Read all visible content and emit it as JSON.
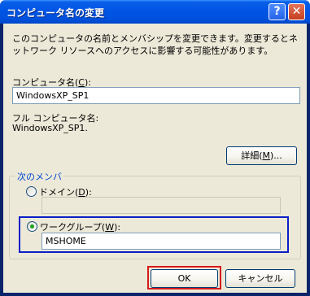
{
  "window": {
    "title": "コンピュータ名の変更",
    "help_button": "?",
    "close_button": "✕"
  },
  "description": "このコンピュータの名前とメンバシップを変更できます。変更するとネットワーク リソースへのアクセスに影響する可能性があります。",
  "computer_name": {
    "label_text": "コンピュータ名(",
    "label_key": "C",
    "label_end": "):",
    "value": "WindowsXP_SP1"
  },
  "full_name": {
    "label": "フル コンピュータ名:",
    "value": "WindowsXP_SP1."
  },
  "details_button": {
    "text": "詳細(",
    "key": "M",
    "end": ")..."
  },
  "member_group": {
    "title": "次のメンバ",
    "domain": {
      "label_text": "ドメイン(",
      "label_key": "D",
      "label_end": "):",
      "value": "",
      "selected": false
    },
    "workgroup": {
      "label_text": "ワークグループ(",
      "label_key": "W",
      "label_end": "):",
      "value": "MSHOME",
      "selected": true
    }
  },
  "footer": {
    "ok_label": "OK",
    "cancel_label": "キャンセル"
  },
  "colors": {
    "titlebar": "#0055e5",
    "dialog_background": "#ece9d8",
    "group_title": "#0046d5",
    "focus_workgroup": "#0c1ec8",
    "focus_ok": "#d61a1a"
  }
}
